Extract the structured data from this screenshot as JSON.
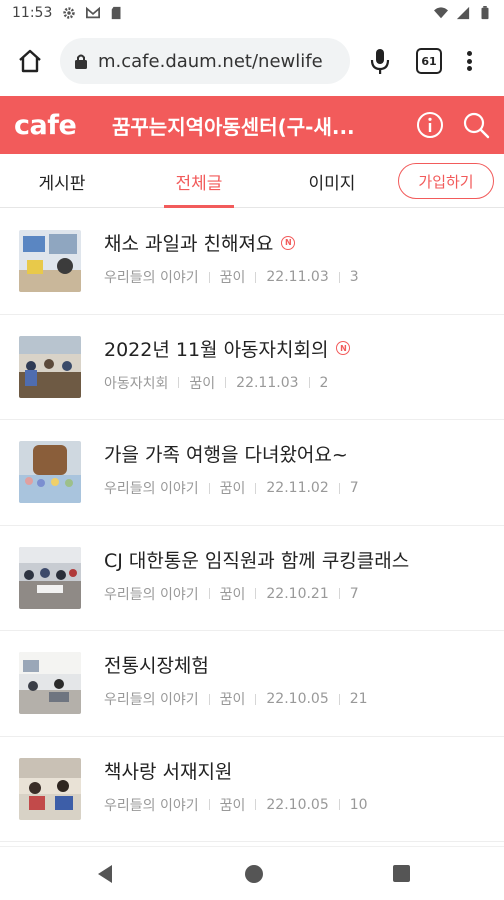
{
  "status_bar": {
    "time": "11:53",
    "icons": [
      "gear-icon",
      "gmail-icon",
      "sd-card-icon",
      "wifi-icon",
      "signal-icon",
      "battery-icon"
    ]
  },
  "browser": {
    "url": "m.cafe.daum.net/newlife",
    "tab_count": "61",
    "icons": [
      "home-icon",
      "lock-icon",
      "mic-icon",
      "tabs-icon",
      "more-vert-icon"
    ]
  },
  "cafe": {
    "logo": "cafe",
    "title": "꿈꾸는지역아동센터(구-새...",
    "accent_color": "#f25b5b"
  },
  "tabs": [
    {
      "label": "게시판",
      "active": false
    },
    {
      "label": "전체글",
      "active": true
    },
    {
      "label": "이미지",
      "active": false
    }
  ],
  "join_label": "가입하기",
  "posts": [
    {
      "title": "채소 과일과 친해져요",
      "new": true,
      "board": "우리들의 이야기",
      "author": "꿈이",
      "date": "22.11.03",
      "comments": "3"
    },
    {
      "title": "2022년 11월 아동자치회의",
      "new": true,
      "board": "아동자치회",
      "author": "꿈이",
      "date": "22.11.03",
      "comments": "2"
    },
    {
      "title": "가을 가족 여행을 다녀왔어요~",
      "new": false,
      "board": "우리들의 이야기",
      "author": "꿈이",
      "date": "22.11.02",
      "comments": "7"
    },
    {
      "title": "CJ 대한통운 임직원과 함께 쿠킹클래스",
      "new": false,
      "board": "우리들의 이야기",
      "author": "꿈이",
      "date": "22.10.21",
      "comments": "7"
    },
    {
      "title": "전통시장체험",
      "new": false,
      "board": "우리들의 이야기",
      "author": "꿈이",
      "date": "22.10.05",
      "comments": "21"
    },
    {
      "title": "책사랑 서재지원",
      "new": false,
      "board": "우리들의 이야기",
      "author": "꿈이",
      "date": "22.10.05",
      "comments": "10"
    }
  ],
  "new_badge": "N"
}
